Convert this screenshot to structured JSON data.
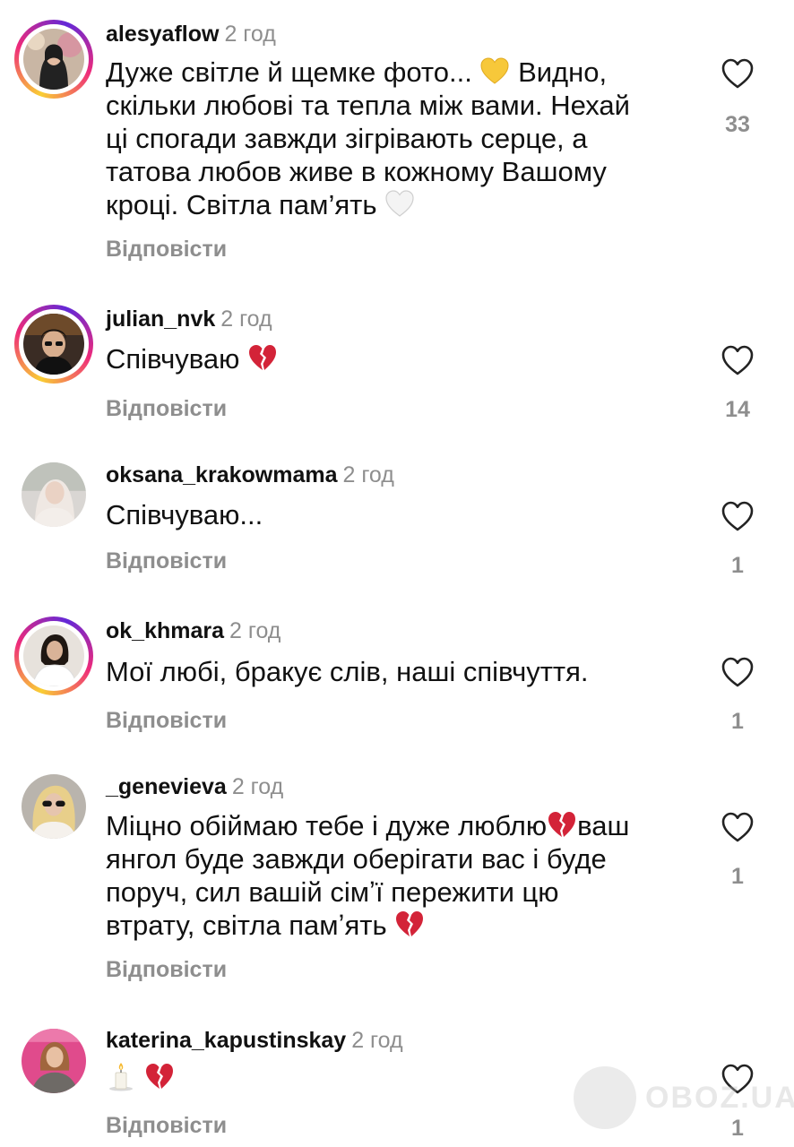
{
  "reply_label": "Відповісти",
  "comments": [
    {
      "username": "alesyaflow",
      "time": "2 год",
      "lines": [
        {
          "text": "Дуже світле й щемке фото... ",
          "emoji": "yellow-heart",
          "after": " Видно,"
        },
        {
          "text": "скільки любові та тепла між вами. Нехай"
        },
        {
          "text": "ці спогади завжди зігрівають серце, а"
        },
        {
          "text": "татова любов живе в кожному Вашому"
        },
        {
          "text": "кроці. Світла пам’ять ",
          "emoji": "white-heart"
        }
      ],
      "likes": "33",
      "story_ring": true
    },
    {
      "username": "julian_nvk",
      "time": "2 год",
      "lines": [
        {
          "text": "Співчуваю ",
          "emoji": "broken-heart"
        }
      ],
      "likes": "14",
      "story_ring": true
    },
    {
      "username": "oksana_krakowmama",
      "time": "2 год",
      "lines": [
        {
          "text": "Співчуваю..."
        }
      ],
      "likes": "1",
      "story_ring": false
    },
    {
      "username": "ok_khmara",
      "time": "2 год",
      "lines": [
        {
          "text": "Мої любі, бракує слів,  наші співчуття."
        }
      ],
      "likes": "1",
      "story_ring": true
    },
    {
      "username": "_genevieva",
      "time": "2 год",
      "lines": [
        {
          "text": "Міцно обіймаю тебе і дуже люблю",
          "emoji": "broken-heart",
          "after": "ваш"
        },
        {
          "text": "янгол буде завжди оберігати вас і буде"
        },
        {
          "text": "поруч, сил вашій сімʼї пережити цю"
        },
        {
          "text": "втрату, світла памʼять ",
          "emoji": "broken-heart"
        }
      ],
      "likes": "1",
      "story_ring": false
    },
    {
      "username": "katerina_kapustinskay",
      "time": "2 год",
      "lines": [
        {
          "text": "",
          "emoji": "candle",
          "after": " ",
          "emoji2": "broken-heart"
        }
      ],
      "likes": "1",
      "story_ring": false
    }
  ],
  "watermark": "OBOZ.UA",
  "colors": {
    "text": "#111111",
    "muted": "#8e8e8e",
    "ring_start": "#f9ce34",
    "ring_mid": "#ee2a7b",
    "ring_end": "#6228d7",
    "broken_heart": "#d32338",
    "yellow_heart": "#f7c83a"
  }
}
